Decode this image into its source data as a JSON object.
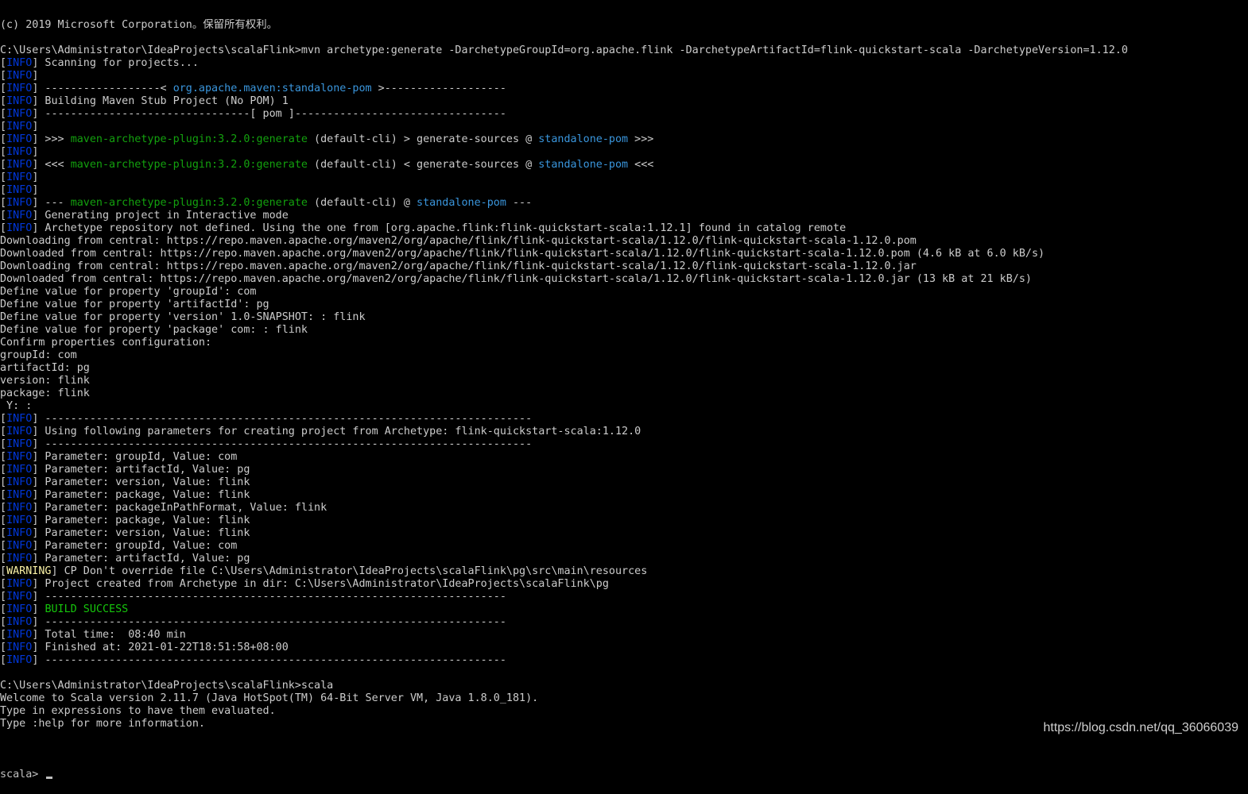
{
  "terminal": {
    "colors": {
      "background": "#000000",
      "text": "#c0c0c0",
      "info_tag": "#0037da",
      "warning_tag": "#f9f1a5",
      "cyan": "#3a96dd",
      "green": "#13a10e",
      "bright_green": "#16c60c"
    },
    "lines": [
      [
        {
          "t": "(c) 2019 Microsoft Corporation。保留所有权利。",
          "c": "white"
        }
      ],
      [
        {
          "t": "",
          "c": "white"
        }
      ],
      [
        {
          "t": "C:\\Users\\Administrator\\IdeaProjects\\scalaFlink>mvn archetype:generate -DarchetypeGroupId=org.apache.flink -DarchetypeArtifactId=flink-quickstart-scala -DarchetypeVersion=1.12.0",
          "c": "white"
        }
      ],
      [
        {
          "t": "[",
          "c": "white"
        },
        {
          "t": "INFO",
          "c": "info"
        },
        {
          "t": "] Scanning for projects...",
          "c": "white"
        }
      ],
      [
        {
          "t": "[",
          "c": "white"
        },
        {
          "t": "INFO",
          "c": "info"
        },
        {
          "t": "]",
          "c": "white"
        }
      ],
      [
        {
          "t": "[",
          "c": "white"
        },
        {
          "t": "INFO",
          "c": "info"
        },
        {
          "t": "] ------------------< ",
          "c": "white"
        },
        {
          "t": "org.apache.maven:standalone-pom",
          "c": "cyan"
        },
        {
          "t": " >-------------------",
          "c": "white"
        }
      ],
      [
        {
          "t": "[",
          "c": "white"
        },
        {
          "t": "INFO",
          "c": "info"
        },
        {
          "t": "] Building Maven Stub Project (No POM) 1",
          "c": "white"
        }
      ],
      [
        {
          "t": "[",
          "c": "white"
        },
        {
          "t": "INFO",
          "c": "info"
        },
        {
          "t": "] --------------------------------[ pom ]---------------------------------",
          "c": "white"
        }
      ],
      [
        {
          "t": "[",
          "c": "white"
        },
        {
          "t": "INFO",
          "c": "info"
        },
        {
          "t": "]",
          "c": "white"
        }
      ],
      [
        {
          "t": "[",
          "c": "white"
        },
        {
          "t": "INFO",
          "c": "info"
        },
        {
          "t": "] >>> ",
          "c": "white"
        },
        {
          "t": "maven-archetype-plugin:3.2.0:generate",
          "c": "green"
        },
        {
          "t": " (default-cli) > generate-sources @ ",
          "c": "white"
        },
        {
          "t": "standalone-pom",
          "c": "cyan"
        },
        {
          "t": " >>>",
          "c": "white"
        }
      ],
      [
        {
          "t": "[",
          "c": "white"
        },
        {
          "t": "INFO",
          "c": "info"
        },
        {
          "t": "]",
          "c": "white"
        }
      ],
      [
        {
          "t": "[",
          "c": "white"
        },
        {
          "t": "INFO",
          "c": "info"
        },
        {
          "t": "] <<< ",
          "c": "white"
        },
        {
          "t": "maven-archetype-plugin:3.2.0:generate",
          "c": "green"
        },
        {
          "t": " (default-cli) < generate-sources @ ",
          "c": "white"
        },
        {
          "t": "standalone-pom",
          "c": "cyan"
        },
        {
          "t": " <<<",
          "c": "white"
        }
      ],
      [
        {
          "t": "[",
          "c": "white"
        },
        {
          "t": "INFO",
          "c": "info"
        },
        {
          "t": "]",
          "c": "white"
        }
      ],
      [
        {
          "t": "[",
          "c": "white"
        },
        {
          "t": "INFO",
          "c": "info"
        },
        {
          "t": "]",
          "c": "white"
        }
      ],
      [
        {
          "t": "[",
          "c": "white"
        },
        {
          "t": "INFO",
          "c": "info"
        },
        {
          "t": "] --- ",
          "c": "white"
        },
        {
          "t": "maven-archetype-plugin:3.2.0:generate",
          "c": "green"
        },
        {
          "t": " (default-cli) @ ",
          "c": "white"
        },
        {
          "t": "standalone-pom",
          "c": "cyan"
        },
        {
          "t": " ---",
          "c": "white"
        }
      ],
      [
        {
          "t": "[",
          "c": "white"
        },
        {
          "t": "INFO",
          "c": "info"
        },
        {
          "t": "] Generating project in Interactive mode",
          "c": "white"
        }
      ],
      [
        {
          "t": "[",
          "c": "white"
        },
        {
          "t": "INFO",
          "c": "info"
        },
        {
          "t": "] Archetype repository not defined. Using the one from [org.apache.flink:flink-quickstart-scala:1.12.1] found in catalog remote",
          "c": "white"
        }
      ],
      [
        {
          "t": "Downloading from central: https://repo.maven.apache.org/maven2/org/apache/flink/flink-quickstart-scala/1.12.0/flink-quickstart-scala-1.12.0.pom",
          "c": "white"
        }
      ],
      [
        {
          "t": "Downloaded from central: https://repo.maven.apache.org/maven2/org/apache/flink/flink-quickstart-scala/1.12.0/flink-quickstart-scala-1.12.0.pom (4.6 kB at 6.0 kB/s)",
          "c": "white"
        }
      ],
      [
        {
          "t": "Downloading from central: https://repo.maven.apache.org/maven2/org/apache/flink/flink-quickstart-scala/1.12.0/flink-quickstart-scala-1.12.0.jar",
          "c": "white"
        }
      ],
      [
        {
          "t": "Downloaded from central: https://repo.maven.apache.org/maven2/org/apache/flink/flink-quickstart-scala/1.12.0/flink-quickstart-scala-1.12.0.jar (13 kB at 21 kB/s)",
          "c": "white"
        }
      ],
      [
        {
          "t": "Define value for property 'groupId': com",
          "c": "white"
        }
      ],
      [
        {
          "t": "Define value for property 'artifactId': pg",
          "c": "white"
        }
      ],
      [
        {
          "t": "Define value for property 'version' 1.0-SNAPSHOT: : flink",
          "c": "white"
        }
      ],
      [
        {
          "t": "Define value for property 'package' com: : flink",
          "c": "white"
        }
      ],
      [
        {
          "t": "Confirm properties configuration:",
          "c": "white"
        }
      ],
      [
        {
          "t": "groupId: com",
          "c": "white"
        }
      ],
      [
        {
          "t": "artifactId: pg",
          "c": "white"
        }
      ],
      [
        {
          "t": "version: flink",
          "c": "white"
        }
      ],
      [
        {
          "t": "package: flink",
          "c": "white"
        }
      ],
      [
        {
          "t": " Y: :",
          "c": "white"
        }
      ],
      [
        {
          "t": "[",
          "c": "white"
        },
        {
          "t": "INFO",
          "c": "info"
        },
        {
          "t": "] ----------------------------------------------------------------------------",
          "c": "white"
        }
      ],
      [
        {
          "t": "[",
          "c": "white"
        },
        {
          "t": "INFO",
          "c": "info"
        },
        {
          "t": "] Using following parameters for creating project from Archetype: flink-quickstart-scala:1.12.0",
          "c": "white"
        }
      ],
      [
        {
          "t": "[",
          "c": "white"
        },
        {
          "t": "INFO",
          "c": "info"
        },
        {
          "t": "] ----------------------------------------------------------------------------",
          "c": "white"
        }
      ],
      [
        {
          "t": "[",
          "c": "white"
        },
        {
          "t": "INFO",
          "c": "info"
        },
        {
          "t": "] Parameter: groupId, Value: com",
          "c": "white"
        }
      ],
      [
        {
          "t": "[",
          "c": "white"
        },
        {
          "t": "INFO",
          "c": "info"
        },
        {
          "t": "] Parameter: artifactId, Value: pg",
          "c": "white"
        }
      ],
      [
        {
          "t": "[",
          "c": "white"
        },
        {
          "t": "INFO",
          "c": "info"
        },
        {
          "t": "] Parameter: version, Value: flink",
          "c": "white"
        }
      ],
      [
        {
          "t": "[",
          "c": "white"
        },
        {
          "t": "INFO",
          "c": "info"
        },
        {
          "t": "] Parameter: package, Value: flink",
          "c": "white"
        }
      ],
      [
        {
          "t": "[",
          "c": "white"
        },
        {
          "t": "INFO",
          "c": "info"
        },
        {
          "t": "] Parameter: packageInPathFormat, Value: flink",
          "c": "white"
        }
      ],
      [
        {
          "t": "[",
          "c": "white"
        },
        {
          "t": "INFO",
          "c": "info"
        },
        {
          "t": "] Parameter: package, Value: flink",
          "c": "white"
        }
      ],
      [
        {
          "t": "[",
          "c": "white"
        },
        {
          "t": "INFO",
          "c": "info"
        },
        {
          "t": "] Parameter: version, Value: flink",
          "c": "white"
        }
      ],
      [
        {
          "t": "[",
          "c": "white"
        },
        {
          "t": "INFO",
          "c": "info"
        },
        {
          "t": "] Parameter: groupId, Value: com",
          "c": "white"
        }
      ],
      [
        {
          "t": "[",
          "c": "white"
        },
        {
          "t": "INFO",
          "c": "info"
        },
        {
          "t": "] Parameter: artifactId, Value: pg",
          "c": "white"
        }
      ],
      [
        {
          "t": "[",
          "c": "white"
        },
        {
          "t": "WARNING",
          "c": "warn"
        },
        {
          "t": "] CP Don't override file C:\\Users\\Administrator\\IdeaProjects\\scalaFlink\\pg\\src\\main\\resources",
          "c": "white"
        }
      ],
      [
        {
          "t": "[",
          "c": "white"
        },
        {
          "t": "INFO",
          "c": "info"
        },
        {
          "t": "] Project created from Archetype in dir: C:\\Users\\Administrator\\IdeaProjects\\scalaFlink\\pg",
          "c": "white"
        }
      ],
      [
        {
          "t": "[",
          "c": "white"
        },
        {
          "t": "INFO",
          "c": "info"
        },
        {
          "t": "] ------------------------------------------------------------------------",
          "c": "white"
        }
      ],
      [
        {
          "t": "[",
          "c": "white"
        },
        {
          "t": "INFO",
          "c": "info"
        },
        {
          "t": "] ",
          "c": "white"
        },
        {
          "t": "BUILD SUCCESS",
          "c": "bgreen"
        }
      ],
      [
        {
          "t": "[",
          "c": "white"
        },
        {
          "t": "INFO",
          "c": "info"
        },
        {
          "t": "] ------------------------------------------------------------------------",
          "c": "white"
        }
      ],
      [
        {
          "t": "[",
          "c": "white"
        },
        {
          "t": "INFO",
          "c": "info"
        },
        {
          "t": "] Total time:  08:40 min",
          "c": "white"
        }
      ],
      [
        {
          "t": "[",
          "c": "white"
        },
        {
          "t": "INFO",
          "c": "info"
        },
        {
          "t": "] Finished at: 2021-01-22T18:51:58+08:00",
          "c": "white"
        }
      ],
      [
        {
          "t": "[",
          "c": "white"
        },
        {
          "t": "INFO",
          "c": "info"
        },
        {
          "t": "] ------------------------------------------------------------------------",
          "c": "white"
        }
      ],
      [
        {
          "t": "",
          "c": "white"
        }
      ],
      [
        {
          "t": "C:\\Users\\Administrator\\IdeaProjects\\scalaFlink>scala",
          "c": "white"
        }
      ],
      [
        {
          "t": "Welcome to Scala version 2.11.7 (Java HotSpot(TM) 64-Bit Server VM, Java 1.8.0_181).",
          "c": "white"
        }
      ],
      [
        {
          "t": "Type in expressions to have them evaluated.",
          "c": "white"
        }
      ],
      [
        {
          "t": "Type :help for more information.",
          "c": "white"
        }
      ],
      [
        {
          "t": "",
          "c": "white"
        }
      ]
    ],
    "prompt": "scala> "
  },
  "watermark": "https://blog.csdn.net/qq_36066039"
}
